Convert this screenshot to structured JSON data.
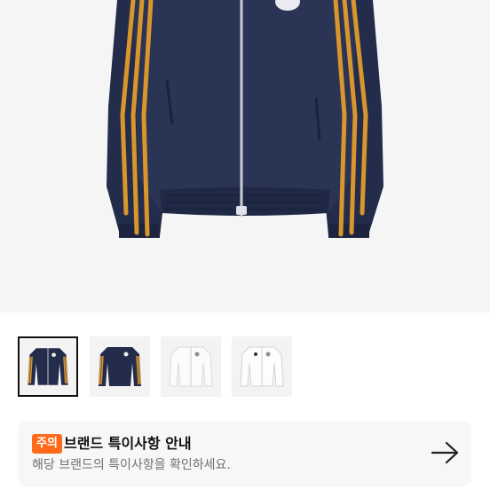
{
  "product": {
    "hero_image": "navy-track-jacket-gold-stripes",
    "colors": {
      "background": "#f5f5f5",
      "jacket_navy": "#232d4b",
      "stripe_gold": "#d9962c",
      "accent": "#ff6a1a"
    }
  },
  "thumbnails": [
    {
      "name": "navy-jacket-front",
      "selected": true
    },
    {
      "name": "navy-jacket-back",
      "selected": false
    },
    {
      "name": "white-jacket-front",
      "selected": false
    },
    {
      "name": "white-jacket-alt",
      "selected": false
    }
  ],
  "notice": {
    "badge": "주의",
    "title": "브랜드 특이사항 안내",
    "subtitle": "해당 브랜드의 특이사항을 확인하세요.",
    "icon": "arrow-right-icon"
  }
}
